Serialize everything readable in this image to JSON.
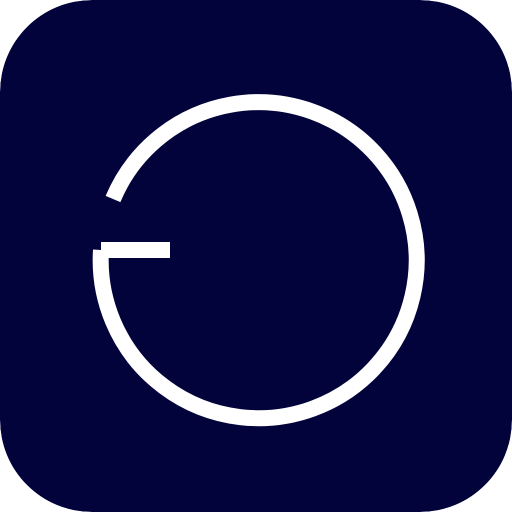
{
  "icon": {
    "name": "app-logo-icon",
    "description_role": "launcher-icon",
    "colors": {
      "background": "#03033c",
      "glyph": "#ffffff",
      "canvas": "#ffffff"
    },
    "glyph_icon": "open-circle-with-notch-icon"
  }
}
